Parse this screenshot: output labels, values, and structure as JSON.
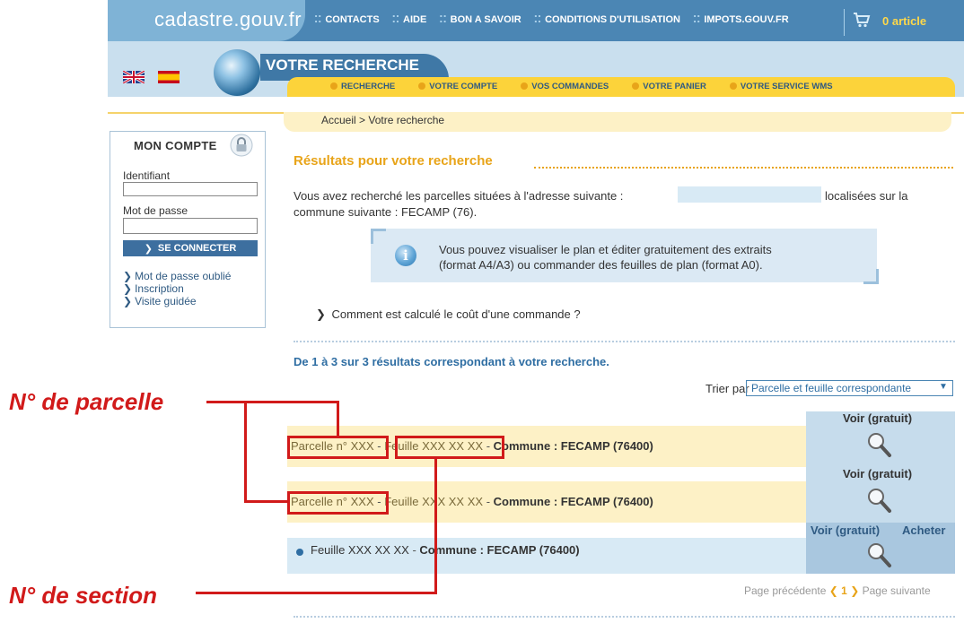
{
  "header": {
    "site": "cadastre.gouv.fr",
    "nav": [
      "CONTACTS",
      "AIDE",
      "BON A SAVOIR",
      "CONDITIONS D'UTILISATION",
      "IMPOTS.GOUV.FR"
    ],
    "cart": "0 article",
    "section_title": "VOTRE RECHERCHE",
    "subnav": [
      "RECHERCHE",
      "VOTRE COMPTE",
      "VOS COMMANDES",
      "VOTRE PANIER",
      "VOTRE SERVICE WMS"
    ],
    "breadcrumb": "Accueil > Votre recherche"
  },
  "sidebar": {
    "title": "MON COMPTE",
    "id_label": "Identifiant",
    "pw_label": "Mot de passe",
    "login": "SE CONNECTER",
    "links": [
      "Mot de passe oublié",
      "Inscription",
      "Visite guidée"
    ]
  },
  "main": {
    "title": "Résultats pour votre recherche",
    "desc_1": "Vous avez recherché les parcelles situées à l'adresse suivante :",
    "desc_2": "localisées sur la",
    "desc_3": "commune suivante : FECAMP (76).",
    "info_1": "Vous pouvez visualiser le plan et éditer gratuitement des extraits",
    "info_2": "(format A4/A3) ou commander des feuilles de plan (format A0).",
    "cost_link": "Comment est calculé le coût d'une commande ?",
    "count": "De 1 à 3 sur 3 résultats correspondant à votre recherche.",
    "sort_label": "Trier par",
    "sort_value": "Parcelle et feuille correspondante",
    "rows": [
      {
        "parcelle": "Parcelle n° XXX",
        "feuille": "Feuille XXX XX XX",
        "commune": "Commune : FECAMP (76400)",
        "action": "Voir (gratuit)"
      },
      {
        "parcelle": "Parcelle n° XXX",
        "feuille": "Feuille XXX XX XX",
        "commune": "Commune : FECAMP (76400)",
        "action": "Voir (gratuit)"
      },
      {
        "feuille": "Feuille XXX XX XX",
        "commune": "Commune : FECAMP (76400)",
        "action": "Voir (gratuit)",
        "buy": "Acheter"
      }
    ],
    "sep": "-",
    "pager": {
      "prev": "Page précédente",
      "current": "1",
      "next": "Page suivante"
    }
  },
  "annotations": {
    "parcelle": "N° de parcelle",
    "section": "N° de section",
    "color": "#d11a1a"
  }
}
